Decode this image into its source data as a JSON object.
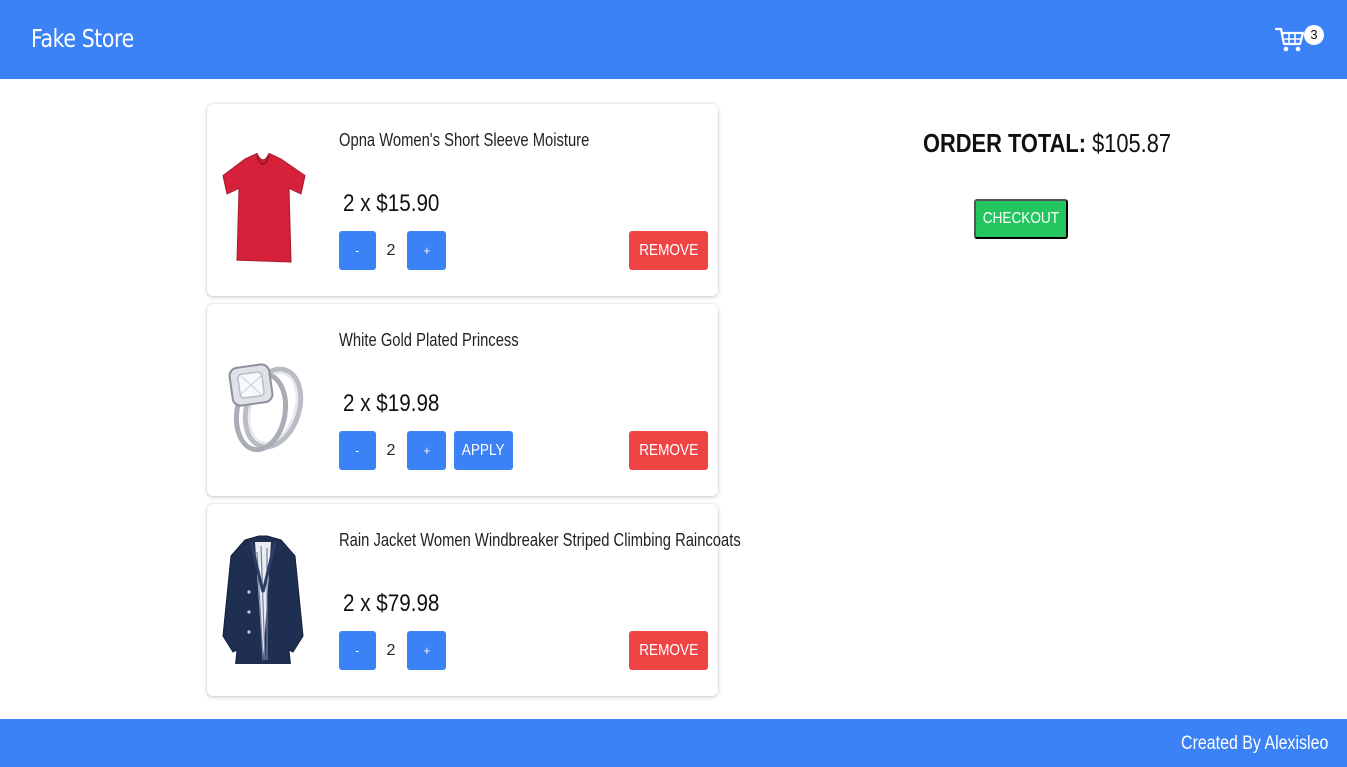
{
  "header": {
    "brand": "Fake Store",
    "cart_count": "3",
    "cart_icon": "shopping-cart-icon"
  },
  "colors": {
    "primary": "#3b82f6",
    "danger": "#ef4444",
    "success": "#22c55e"
  },
  "cart": {
    "items": [
      {
        "title": "Opna Women's Short Sleeve Moisture",
        "price_line": "2 x $15.90",
        "qty": "2",
        "minus_label": "-",
        "plus_label": "+",
        "remove_label": "REMOVE",
        "image": "red-tshirt"
      },
      {
        "title": "White Gold Plated Princess",
        "price_line": "2 x $19.98",
        "qty": "2",
        "minus_label": "-",
        "plus_label": "+",
        "apply_label": "APPLY",
        "remove_label": "REMOVE",
        "image": "diamond-ring"
      },
      {
        "title": "Rain Jacket Women Windbreaker Striped Climbing Raincoats",
        "price_line": "2 x $79.98",
        "qty": "2",
        "minus_label": "-",
        "plus_label": "+",
        "remove_label": "REMOVE",
        "image": "navy-raincoat"
      }
    ]
  },
  "summary": {
    "total_label": "ORDER TOTAL:",
    "total_value": "$105.87",
    "checkout_label": "CHECKOUT"
  },
  "footer": {
    "credits": "Created By Alexisleo"
  }
}
